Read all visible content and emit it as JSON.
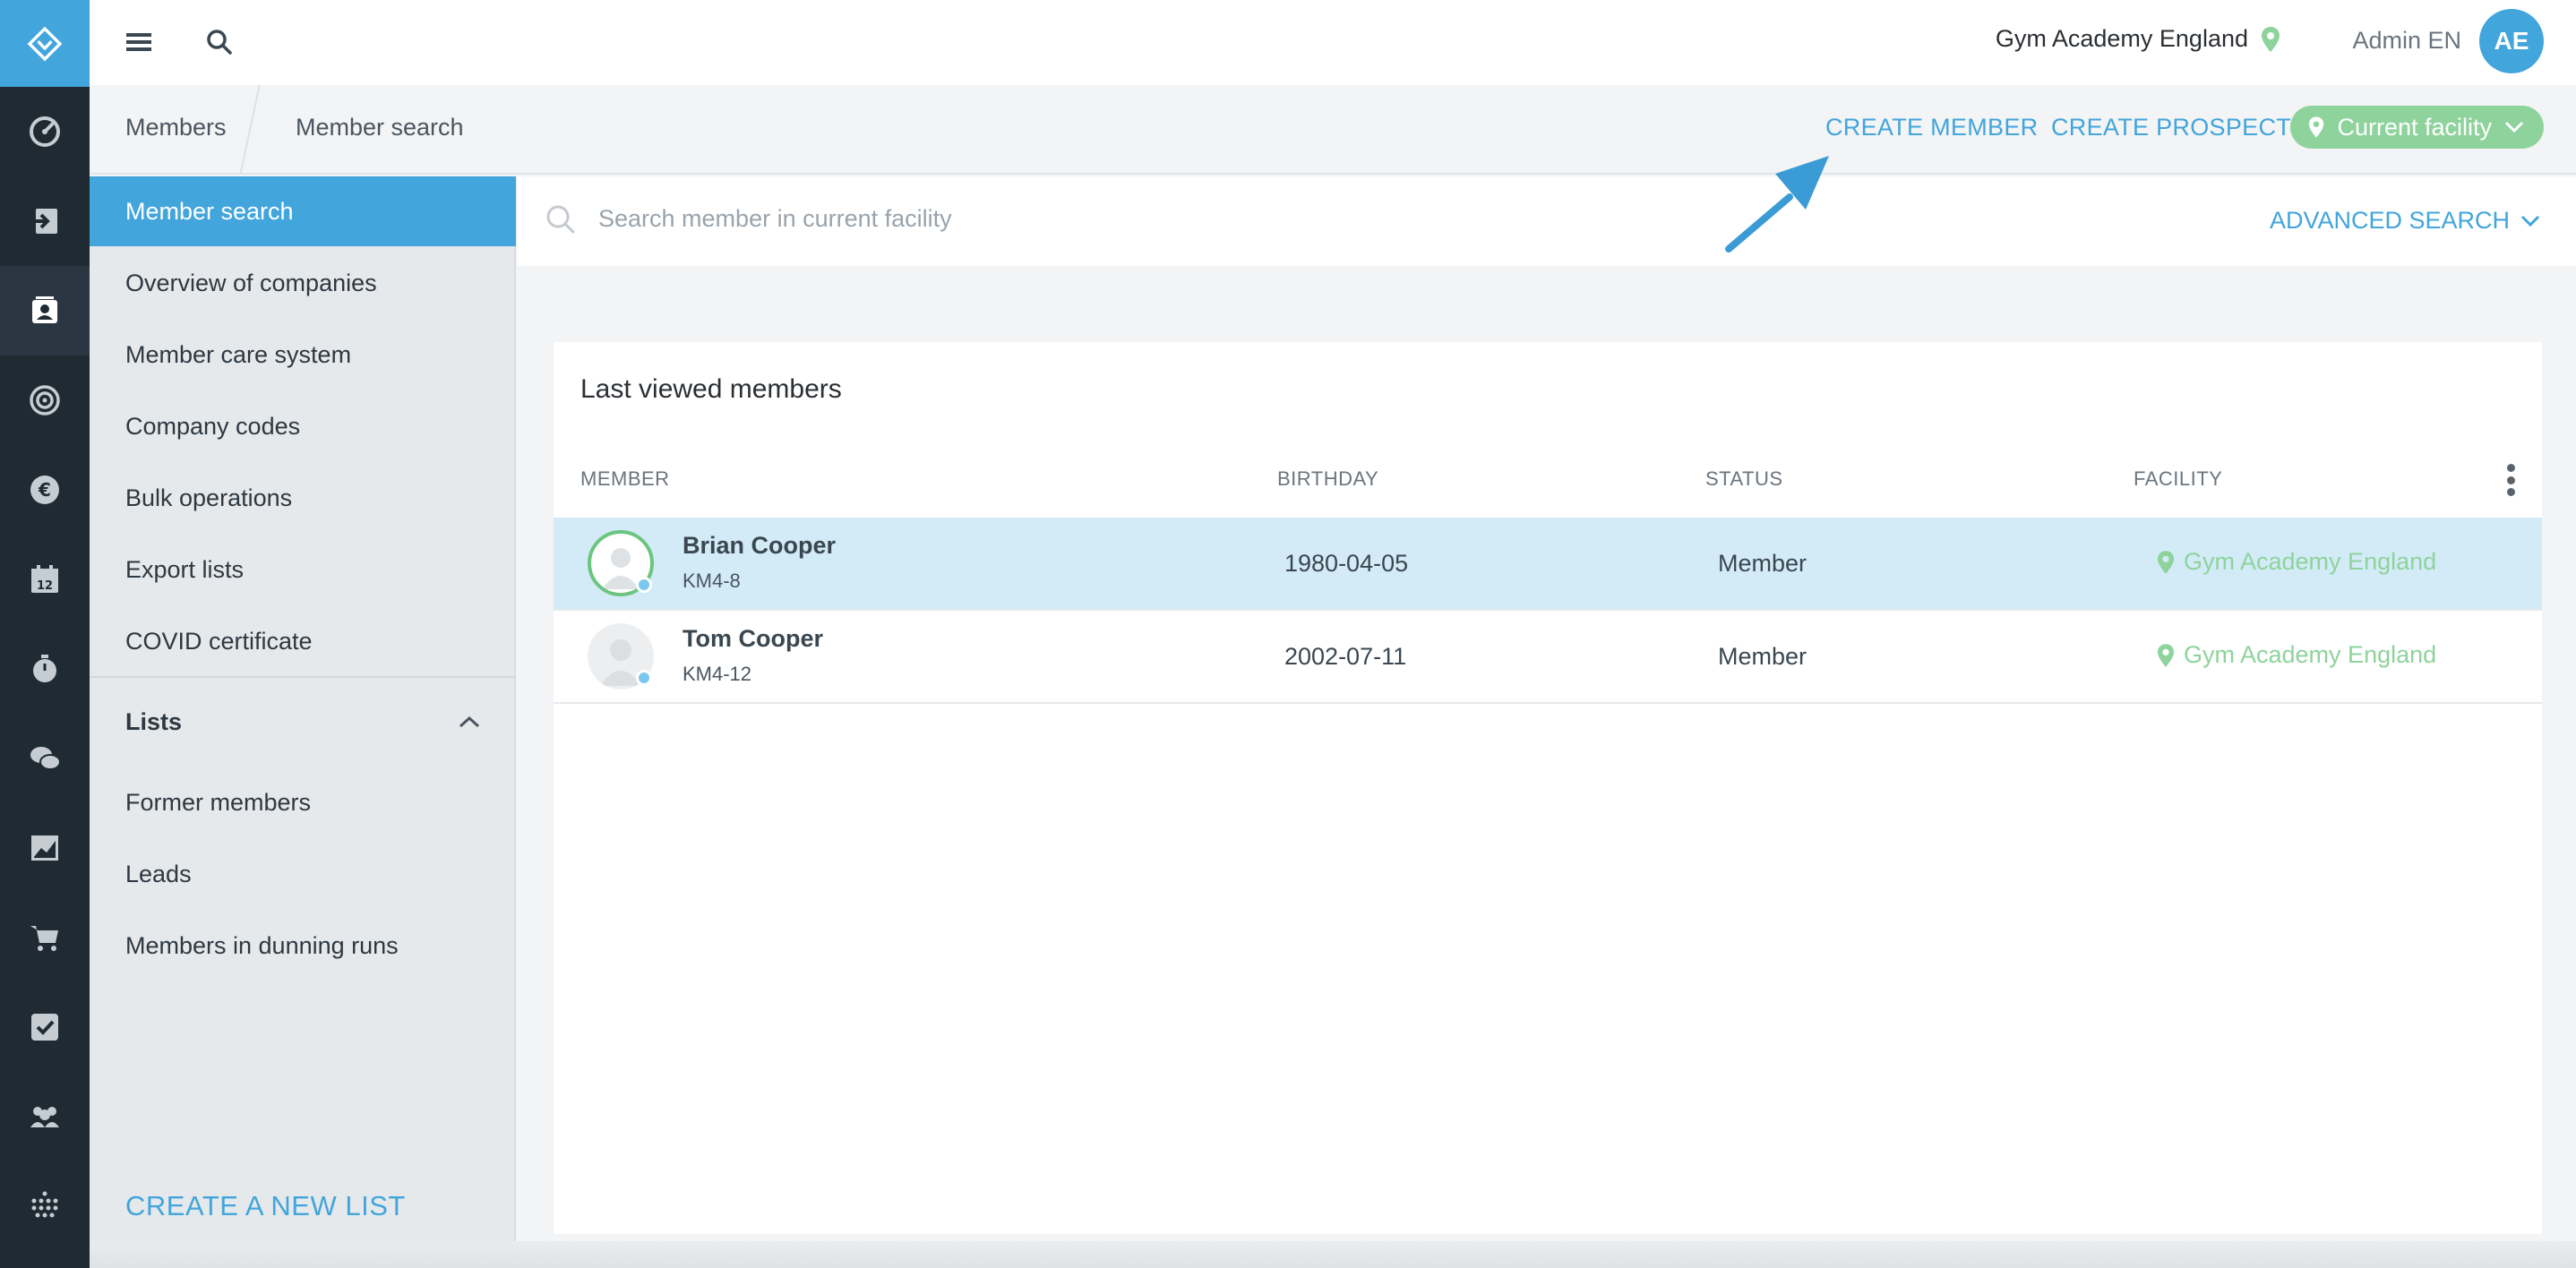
{
  "colors": {
    "accent": "#42a5db",
    "success": "#8ed39c",
    "rail": "#1f2a33"
  },
  "rail": {
    "logo": "logo-icon",
    "items": [
      {
        "icon": "dashboard-icon"
      },
      {
        "icon": "check-in-icon"
      },
      {
        "icon": "members-icon",
        "active": true
      },
      {
        "icon": "target-icon"
      },
      {
        "icon": "euro-icon"
      },
      {
        "icon": "calendar-icon",
        "badge": "12"
      },
      {
        "icon": "timer-icon"
      },
      {
        "icon": "chat-icon"
      },
      {
        "icon": "analytics-icon"
      },
      {
        "icon": "cart-icon"
      },
      {
        "icon": "tasks-icon"
      },
      {
        "icon": "groups-icon"
      },
      {
        "icon": "apps-grid-icon"
      }
    ]
  },
  "topbar": {
    "facility": "Gym Academy England",
    "user": "Admin EN",
    "avatar": "AE"
  },
  "breadcrumb": {
    "root": "Members",
    "current": "Member search"
  },
  "actions": {
    "create_member": "CREATE MEMBER",
    "create_prospect": "CREATE PROSPECT",
    "facility_filter": "Current facility"
  },
  "sidebar": {
    "items": [
      {
        "label": "Member search",
        "active": true
      },
      {
        "label": "Overview of companies"
      },
      {
        "label": "Member care system"
      },
      {
        "label": "Company codes"
      },
      {
        "label": "Bulk operations"
      },
      {
        "label": "Export lists"
      },
      {
        "label": "COVID certificate"
      }
    ],
    "lists_heading": "Lists",
    "lists": [
      {
        "label": "Former members"
      },
      {
        "label": "Leads"
      },
      {
        "label": "Members in dunning runs"
      }
    ],
    "create_list": "CREATE A NEW LIST"
  },
  "search": {
    "placeholder": "Search member in current facility",
    "advanced": "ADVANCED SEARCH"
  },
  "last_viewed": {
    "title": "Last viewed members",
    "columns": [
      "MEMBER",
      "BIRTHDAY",
      "STATUS",
      "FACILITY"
    ],
    "rows": [
      {
        "name": "Brian Cooper",
        "code": "KM4-8",
        "birthday": "1980-04-05",
        "status": "Member",
        "facility": "Gym Academy England",
        "selected": true
      },
      {
        "name": "Tom Cooper",
        "code": "KM4-12",
        "birthday": "2002-07-11",
        "status": "Member",
        "facility": "Gym Academy England",
        "selected": false
      }
    ]
  }
}
